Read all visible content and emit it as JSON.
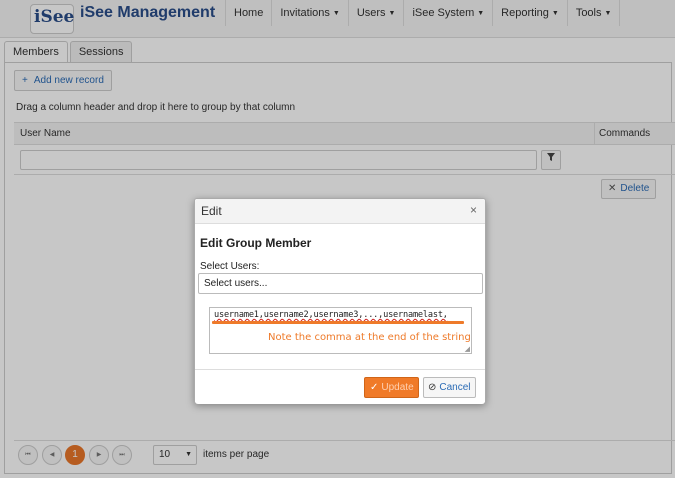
{
  "app": {
    "logo": "iSee",
    "title": "iSee Management"
  },
  "nav": [
    {
      "label": "Home",
      "caret": false
    },
    {
      "label": "Invitations",
      "caret": true
    },
    {
      "label": "Users",
      "caret": true
    },
    {
      "label": "iSee System",
      "caret": true
    },
    {
      "label": "Reporting",
      "caret": true
    },
    {
      "label": "Tools",
      "caret": true
    }
  ],
  "tabs": [
    {
      "label": "Members",
      "active": true
    },
    {
      "label": "Sessions",
      "active": false
    }
  ],
  "grid": {
    "add_label": "Add new record",
    "group_hint": "Drag a column header and drop it here to group by that column",
    "col_user": "User Name",
    "col_commands": "Commands",
    "delete_label": "Delete"
  },
  "pager": {
    "current_page": "1",
    "page_size": "10",
    "per_page_label": "items per page"
  },
  "dialog": {
    "title": "Edit",
    "heading": "Edit Group Member",
    "select_label": "Select Users:",
    "select_placeholder": "Select users...",
    "textarea_value": "username1,username2,username3,...,usernamelast,",
    "annotation": "Note the comma at the end of the string",
    "update_label": "Update",
    "cancel_label": "Cancel"
  },
  "colors": {
    "accent": "#f07a28",
    "link": "#2b6bb5",
    "brand": "#2a4d8a"
  }
}
